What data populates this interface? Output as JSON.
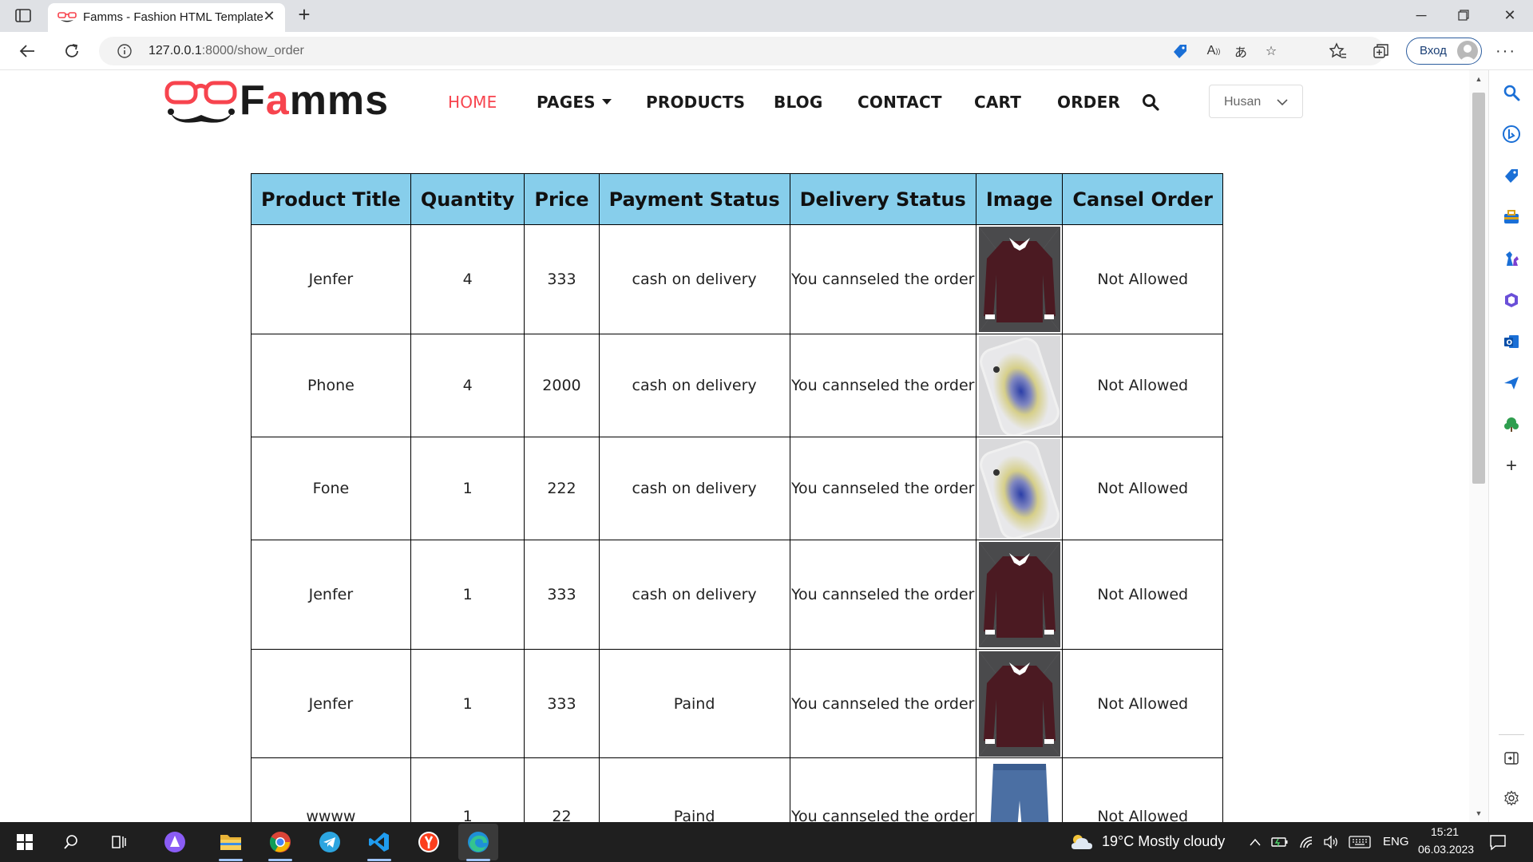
{
  "browser": {
    "tab_title": "Famms - Fashion HTML Template",
    "url_host": "127.0.0.1",
    "url_rest": ":8000/show_order",
    "signin_label": "Вход"
  },
  "site": {
    "logo_text_f": "F",
    "logo_text_a": "a",
    "logo_text_rest": "mms",
    "nav": {
      "home": "HOME",
      "pages": "PAGES",
      "products": "PRODUCTS",
      "blog": "BLOG",
      "contact": "CONTACT",
      "cart": "CART",
      "order": "ORDER"
    },
    "user_dropdown": "Husan"
  },
  "orders_table": {
    "headers": [
      "Product Title",
      "Quantity",
      "Price",
      "Payment Status",
      "Delivery Status",
      "Image",
      "Cansel Order"
    ],
    "rows": [
      {
        "title": "Jenfer",
        "quantity": "4",
        "price": "333",
        "payment": "cash on delivery",
        "delivery": "You cannseled the order",
        "image": "sweater",
        "action": "Not Allowed"
      },
      {
        "title": "Phone",
        "quantity": "4",
        "price": "2000",
        "payment": "cash on delivery",
        "delivery": "You cannseled the order",
        "image": "phone",
        "action": "Not Allowed"
      },
      {
        "title": "Fone",
        "quantity": "1",
        "price": "222",
        "payment": "cash on delivery",
        "delivery": "You cannseled the order",
        "image": "phone",
        "action": "Not Allowed"
      },
      {
        "title": "Jenfer",
        "quantity": "1",
        "price": "333",
        "payment": "cash on delivery",
        "delivery": "You cannseled the order",
        "image": "sweater",
        "action": "Not Allowed"
      },
      {
        "title": "Jenfer",
        "quantity": "1",
        "price": "333",
        "payment": "Paind",
        "delivery": "You cannseled the order",
        "image": "sweater",
        "action": "Not Allowed"
      },
      {
        "title": "wwww",
        "quantity": "1",
        "price": "22",
        "payment": "Paind",
        "delivery": "You cannseled the order",
        "image": "jeans",
        "action": "Not Allowed"
      }
    ]
  },
  "taskbar": {
    "weather": "19°C  Mostly cloudy",
    "language": "ENG",
    "time": "15:21",
    "date": "06.03.2023"
  },
  "colors": {
    "brand_red": "#f7444e",
    "table_header": "#87ceeb",
    "link_blue": "#1a1adb"
  }
}
